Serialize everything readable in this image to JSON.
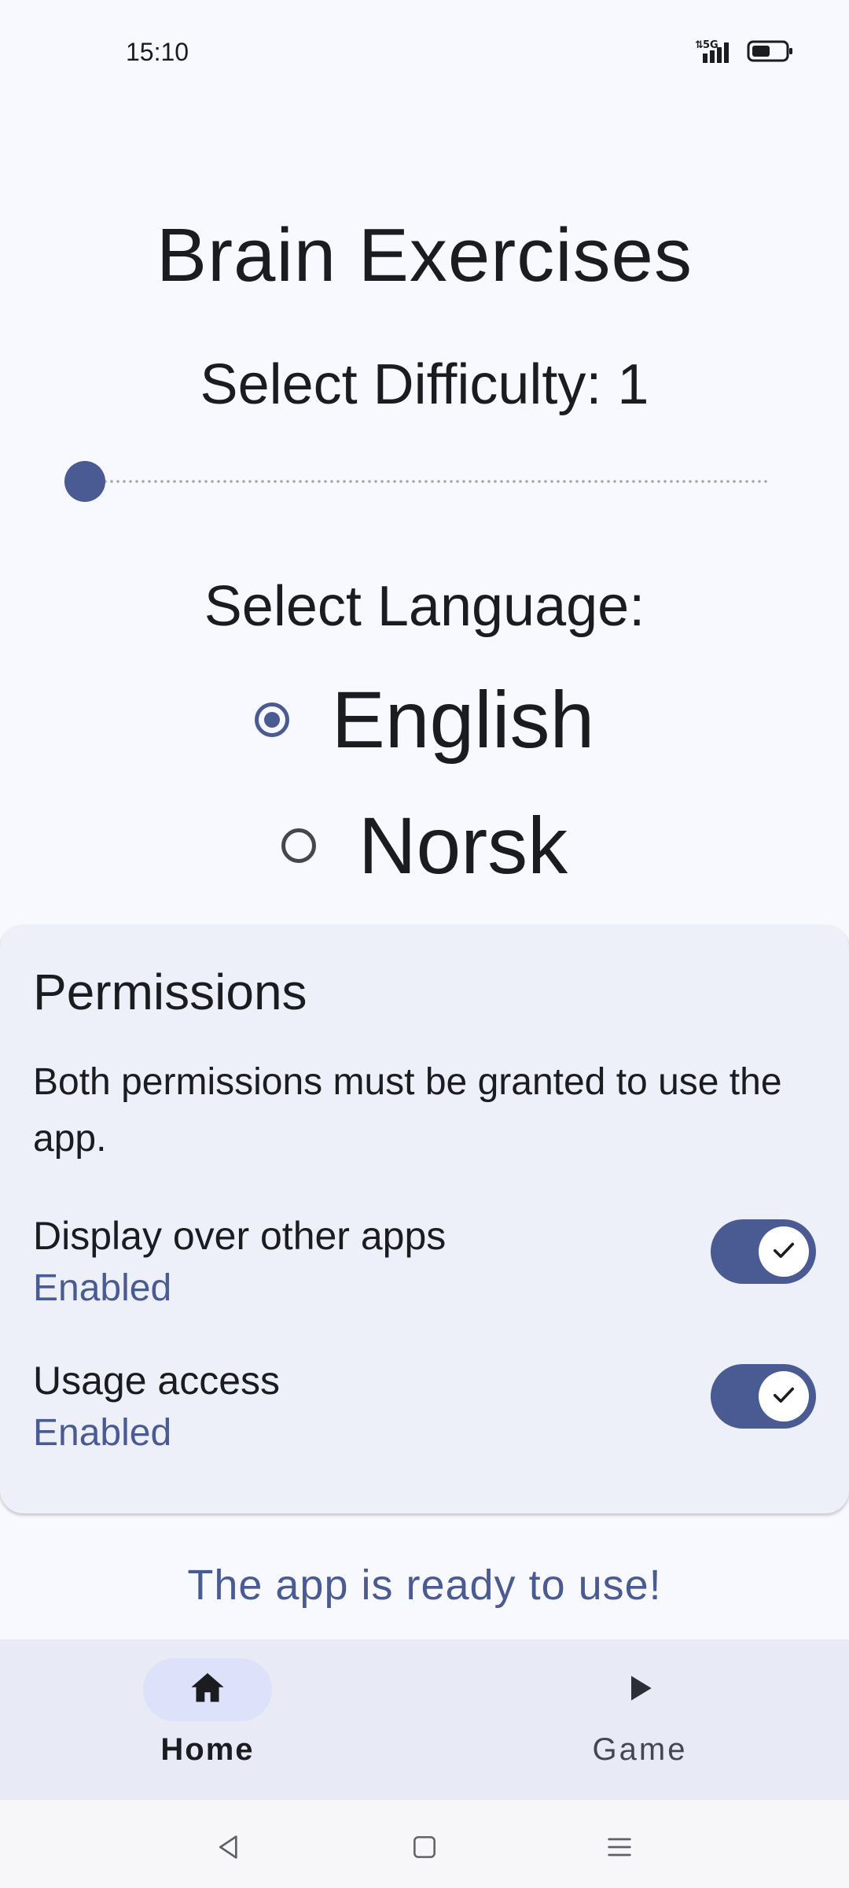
{
  "status_bar": {
    "time": "15:10",
    "network": "5G",
    "icons": [
      "signal-5g-icon",
      "battery-icon"
    ]
  },
  "app": {
    "title": "Brain Exercises"
  },
  "difficulty": {
    "label": "Select Difficulty: 1",
    "value": 1
  },
  "language": {
    "label": "Select Language:",
    "options": [
      {
        "label": "English",
        "selected": true
      },
      {
        "label": "Norsk",
        "selected": false
      }
    ]
  },
  "permissions": {
    "title": "Permissions",
    "description": "Both permissions must be granted to use the app.",
    "items": [
      {
        "name": "Display over other apps",
        "status": "Enabled",
        "enabled": true
      },
      {
        "name": "Usage access",
        "status": "Enabled",
        "enabled": true
      }
    ]
  },
  "ready_message": "The app is ready to use!",
  "bottom_nav": {
    "items": [
      {
        "label": "Home",
        "icon": "home-icon",
        "selected": true
      },
      {
        "label": "Game",
        "icon": "play-icon",
        "selected": false
      }
    ]
  },
  "system_nav": [
    "back-icon",
    "home-square-icon",
    "menu-icon"
  ],
  "colors": {
    "accent": "#4a5a92",
    "background": "#f8f9fe",
    "card": "#edeff9",
    "nav_bar": "#e8eaf5",
    "nav_pill": "#dde1f9",
    "text": "#1b1c20"
  }
}
